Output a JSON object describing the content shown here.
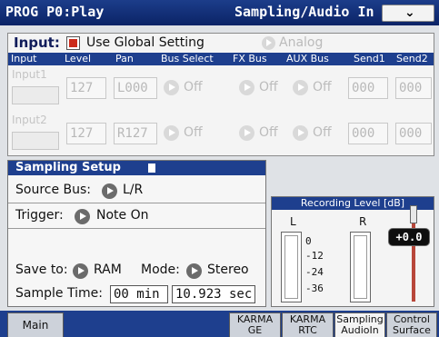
{
  "title_bar": {
    "left": "PROG P0:Play",
    "right": "Sampling/Audio In",
    "menu_icon": "chevron-down-icon"
  },
  "input_section": {
    "label": "Input:",
    "use_global_checked": true,
    "use_global_label": "Use Global Setting",
    "analog_label": "Analog",
    "columns": [
      "Input",
      "Level",
      "Pan",
      "Bus Select",
      "FX Bus",
      "AUX Bus",
      "Send1",
      "Send2"
    ],
    "rows": [
      {
        "name": "Input1",
        "level": "127",
        "pan": "L000",
        "bus_select": "Off",
        "fx_bus": "Off",
        "aux_bus": "Off",
        "send1": "000",
        "send2": "000"
      },
      {
        "name": "Input2",
        "level": "127",
        "pan": "R127",
        "bus_select": "Off",
        "fx_bus": "Off",
        "aux_bus": "Off",
        "send1": "000",
        "send2": "000"
      }
    ]
  },
  "sampling_setup": {
    "title": "Sampling Setup",
    "source_bus_label": "Source Bus:",
    "source_bus_value": "L/R",
    "trigger_label": "Trigger:",
    "trigger_value": "Note On",
    "save_to_label": "Save to:",
    "save_to_value": "RAM",
    "mode_label": "Mode:",
    "mode_value": "Stereo",
    "sample_time_label": "Sample Time:",
    "sample_time_min": "00 min",
    "sample_time_sec": "10.923 sec"
  },
  "recording_level": {
    "title": "Recording Level [dB]",
    "left_label": "L",
    "right_label": "R",
    "ticks": [
      "0",
      "-12",
      "-24",
      "-36"
    ],
    "gain_value": "+0.0"
  },
  "tabs": [
    {
      "label_line1": "Main",
      "label_line2": ""
    },
    {
      "label_line1": "KARMA",
      "label_line2": "GE"
    },
    {
      "label_line1": "KARMA",
      "label_line2": "RTC"
    },
    {
      "label_line1": "Sampling",
      "label_line2": "AudioIn"
    },
    {
      "label_line1": "Control",
      "label_line2": "Surface"
    }
  ],
  "colors": {
    "header_blue": "#1e3f8e",
    "checkbox_red": "#cc2a1a",
    "gain_slider": "#b8473a"
  }
}
